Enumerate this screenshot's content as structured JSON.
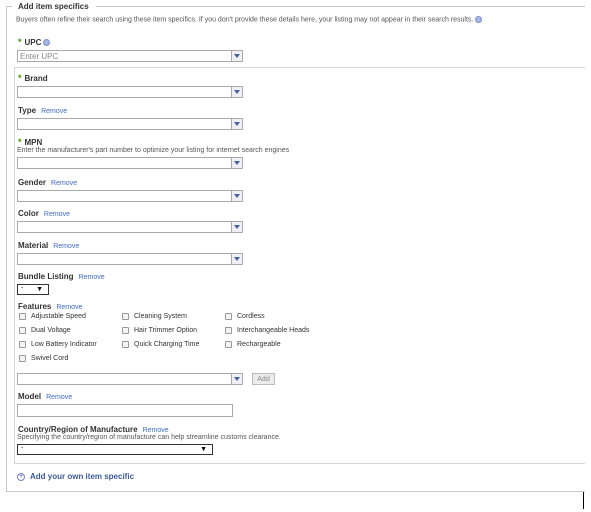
{
  "section": {
    "legend": "Add item specifics",
    "intro": "Buyers often refine their search using these item specifics. If you don't provide these details here, your listing may not appear in their search results."
  },
  "upc": {
    "label": "UPC",
    "placeholder": "Enter UPC"
  },
  "brand": {
    "label": "Brand"
  },
  "type": {
    "label": "Type",
    "remove": "Remove"
  },
  "mpn": {
    "label": "MPN",
    "hint": "Enter the manufacturer's part number to optimize your listing for internet search engines"
  },
  "gender": {
    "label": "Gender",
    "remove": "Remove"
  },
  "color": {
    "label": "Color",
    "remove": "Remove"
  },
  "material": {
    "label": "Material",
    "remove": "Remove"
  },
  "bundle": {
    "label": "Bundle Listing",
    "remove": "Remove",
    "value": "-",
    "arrow": "▼"
  },
  "features": {
    "label": "Features",
    "remove": "Remove",
    "options": [
      "Adjustable Speed",
      "Cleaning System",
      "Cordless",
      "Dual Voltage",
      "Hair Trimmer Option",
      "Interchangeable Heads",
      "Low Battery Indicator",
      "Quick Charging Time",
      "Rechargeable",
      "Swivel Cord"
    ],
    "add_label": "Add"
  },
  "model": {
    "label": "Model",
    "remove": "Remove"
  },
  "country": {
    "label": "Country/Region of Manufacture",
    "remove": "Remove",
    "hint": "Specifying the country/region of manufacture can help streamline customs clearance.",
    "value": "-",
    "arrow": "▼"
  },
  "add_own": {
    "label": "Add your own item specific"
  },
  "colors": {
    "required_star": "#3c9a00",
    "link": "#3d6bc9"
  }
}
